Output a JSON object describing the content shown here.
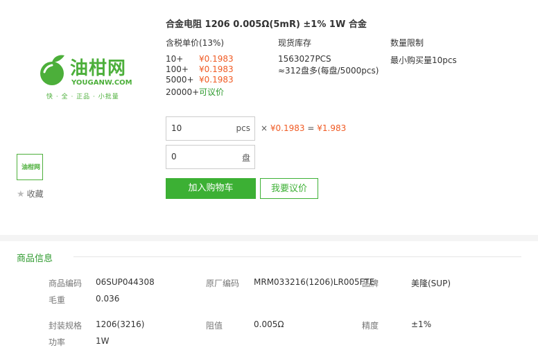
{
  "logo": {
    "name": "油柑网",
    "domain": "YOUGANW.COM",
    "slogan": "快 · 全 · 正品 · 小批量"
  },
  "thumb": {
    "label": "油柑网"
  },
  "favorite": {
    "label": "收藏"
  },
  "product": {
    "title": "合金电阻 1206 0.005Ω(5mR) ±1% 1W 合金",
    "price_header": "含税单价(13%)",
    "stock_header": "现货库存",
    "limit_header": "数量限制",
    "tiers": [
      {
        "qty": "10+",
        "price": "¥0.1983"
      },
      {
        "qty": "100+",
        "price": "¥0.1983"
      },
      {
        "qty": "5000+",
        "price": "¥0.1983"
      },
      {
        "qty": "20000+",
        "price": "可议价"
      }
    ],
    "stock": "1563027PCS",
    "stock_reels": "≈312盘多(每盘/5000pcs)",
    "limit": "最小购买量10pcs"
  },
  "order": {
    "qty_value": "10",
    "qty_unit": "pcs",
    "times": "×",
    "unit_price": "¥0.1983",
    "equals": "=",
    "total": "¥1.983",
    "reel_value": "0",
    "reel_unit": "盘",
    "add_to_cart": "加入购物车",
    "quote": "我要议价"
  },
  "info": {
    "title": "商品信息",
    "rows": [
      [
        {
          "label": "商品编码",
          "value": "06SUP044308"
        },
        {
          "label": "原厂编码",
          "value": "MRM033216(1206)LR005FTE"
        },
        {
          "label": "品牌",
          "value": "美隆(SUP)"
        }
      ],
      [
        {
          "label": "毛重",
          "value": "0.036"
        }
      ],
      [
        {
          "label": "封装规格",
          "value": "1206(3216)"
        },
        {
          "label": "阻值",
          "value": "0.005Ω"
        },
        {
          "label": "精度",
          "value": "±1%"
        }
      ],
      [
        {
          "label": "功率",
          "value": "1W"
        }
      ]
    ]
  },
  "colors": {
    "brand_green": "#3cb034",
    "price_orange": "#f05a23"
  }
}
